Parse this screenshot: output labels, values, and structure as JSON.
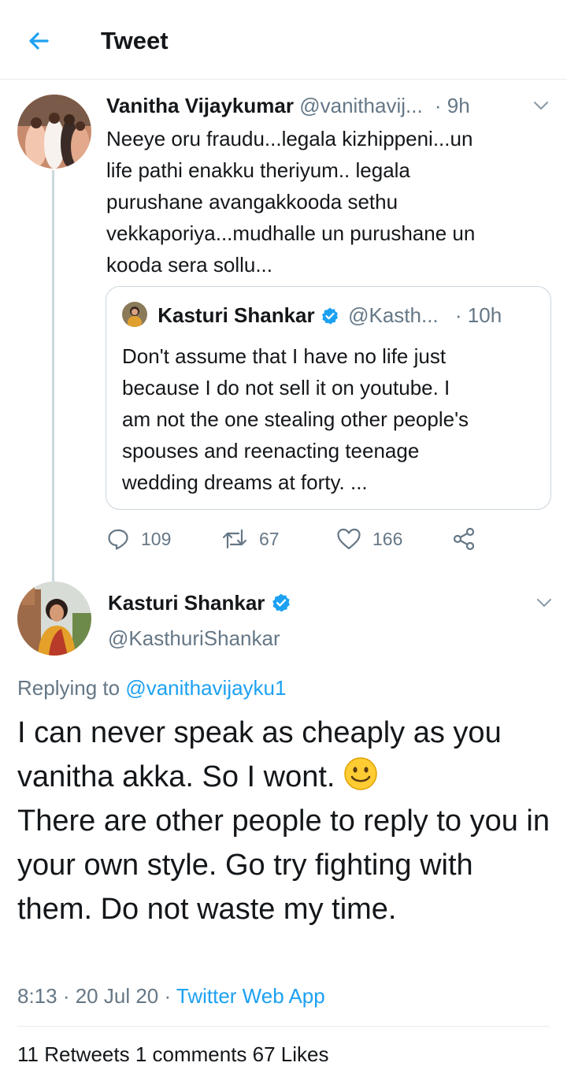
{
  "header": {
    "title": "Tweet"
  },
  "parent_tweet": {
    "name": "Vanitha Vijaykumar",
    "handle": "@vanithavij...",
    "time": "· 9h",
    "text": "Neeye oru fraudu...legala kizhippeni...un\nlife pathi enakku theriyum.. legala\npurushane avangakkooda sethu\nvekkaporiya...mudhalle un purushane un\nkooda sera sollu...",
    "quoted": {
      "name": "Kasturi Shankar",
      "handle": "@Kasth...",
      "time": "· 10h",
      "text": "Don't assume that I have no life just\nbecause I do not sell it on youtube. I\nam not the one stealing other people's\nspouses and reenacting teenage\nwedding dreams at forty. ..."
    },
    "actions": {
      "replies": "109",
      "retweets": "67",
      "likes": "166"
    }
  },
  "main_tweet": {
    "name": "Kasturi Shankar",
    "handle": "@KasthuriShankar",
    "replying_prefix": "Replying to ",
    "replying_handle": "@vanithavijayku1",
    "text_part1": "I can never speak as cheaply  as you  vanitha akka.  So I wont. ",
    "text_part2": "There are other people to reply to you in your own style. Go try fighting with them. Do not waste my time.",
    "time": "8:13 · 20 Jul 20 · ",
    "source": "Twitter Web App",
    "stats_partial": "11 Retweets     1 comments     67 Likes"
  },
  "colors": {
    "accent": "#1da1f2",
    "muted": "#657786",
    "border": "#ccd6dd",
    "verified": "#1da1f2"
  },
  "icons": [
    "back-arrow-icon",
    "chevron-down-icon",
    "verified-badge-icon",
    "reply-icon",
    "retweet-icon",
    "like-icon",
    "share-icon",
    "smiley-emoji-icon"
  ]
}
